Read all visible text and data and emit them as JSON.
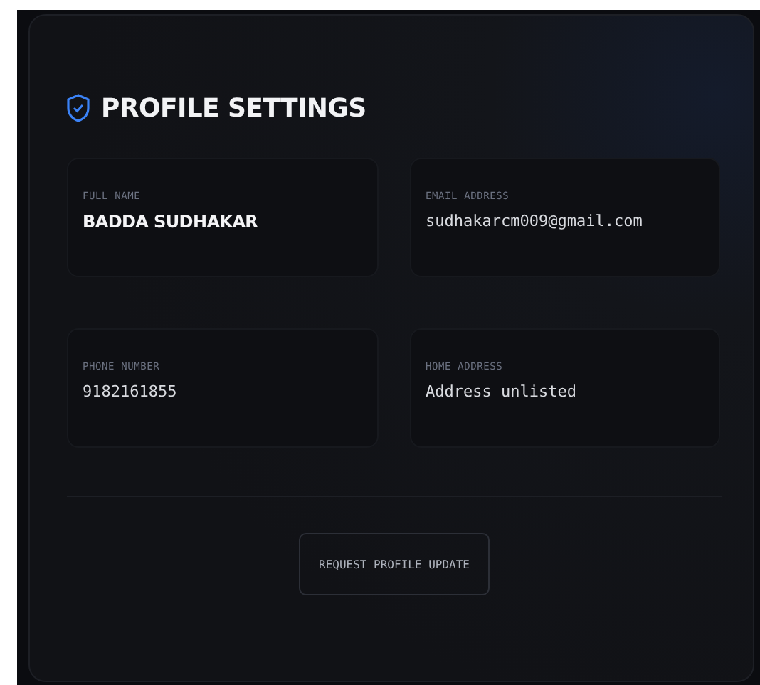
{
  "title": "PROFILE SETTINGS",
  "fields": [
    {
      "label": "FULL NAME",
      "value": "BADDA SUDHAKAR",
      "kind": "heading"
    },
    {
      "label": "EMAIL ADDRESS",
      "value": "sudhakarcm009@gmail.com",
      "kind": "mono"
    },
    {
      "label": "PHONE NUMBER",
      "value": "9182161855",
      "kind": "mono"
    },
    {
      "label": "HOME ADDRESS",
      "value": "Address unlisted",
      "kind": "mono"
    }
  ],
  "button": "REQUEST PROFILE UPDATE"
}
